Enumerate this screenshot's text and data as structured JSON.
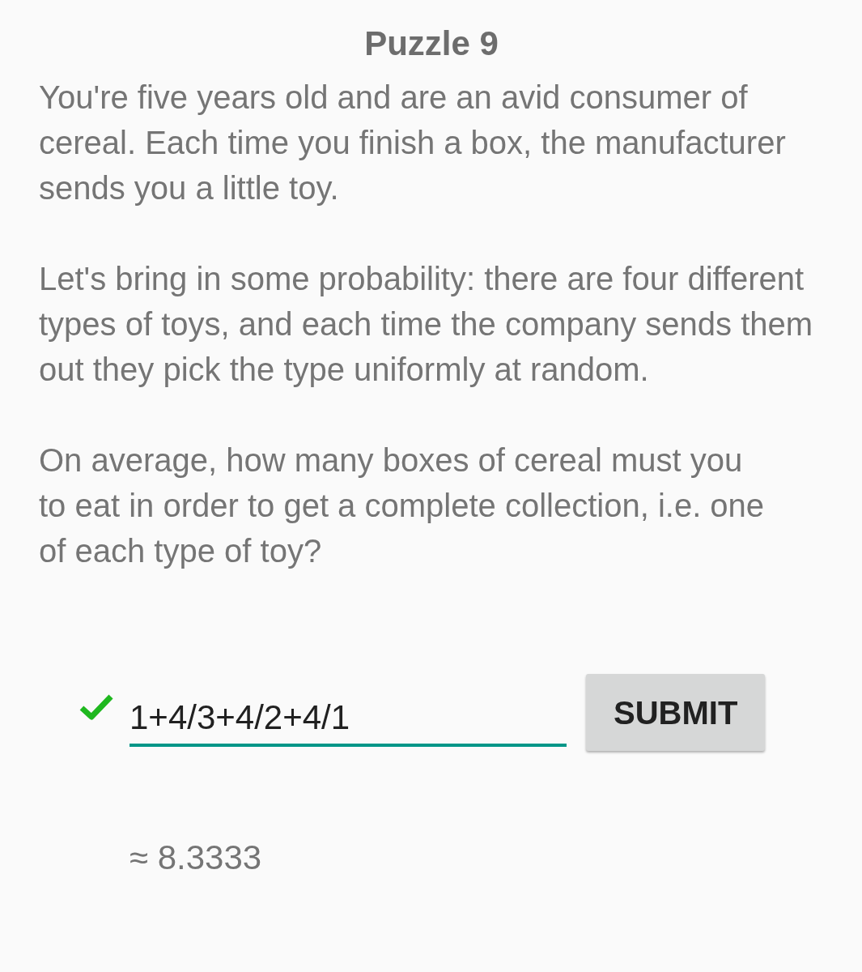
{
  "title": "Puzzle 9",
  "paragraphs": [
    "You're five years old and are an avid consumer of cereal. Each time you finish a box, the manufacturer sends you a little toy.",
    "Let's bring in some probability: there are four different types of toys, and each time the company sends them out they pick the type uniformly at random.",
    "On average, how many boxes of cereal must you to eat in order to get a complete collection, i.e. one of each type of toy?"
  ],
  "answer": {
    "value": "1+4/3+4/2+4/1",
    "correct": true
  },
  "submit_button": "SUBMIT",
  "result": "≈ 8.3333"
}
